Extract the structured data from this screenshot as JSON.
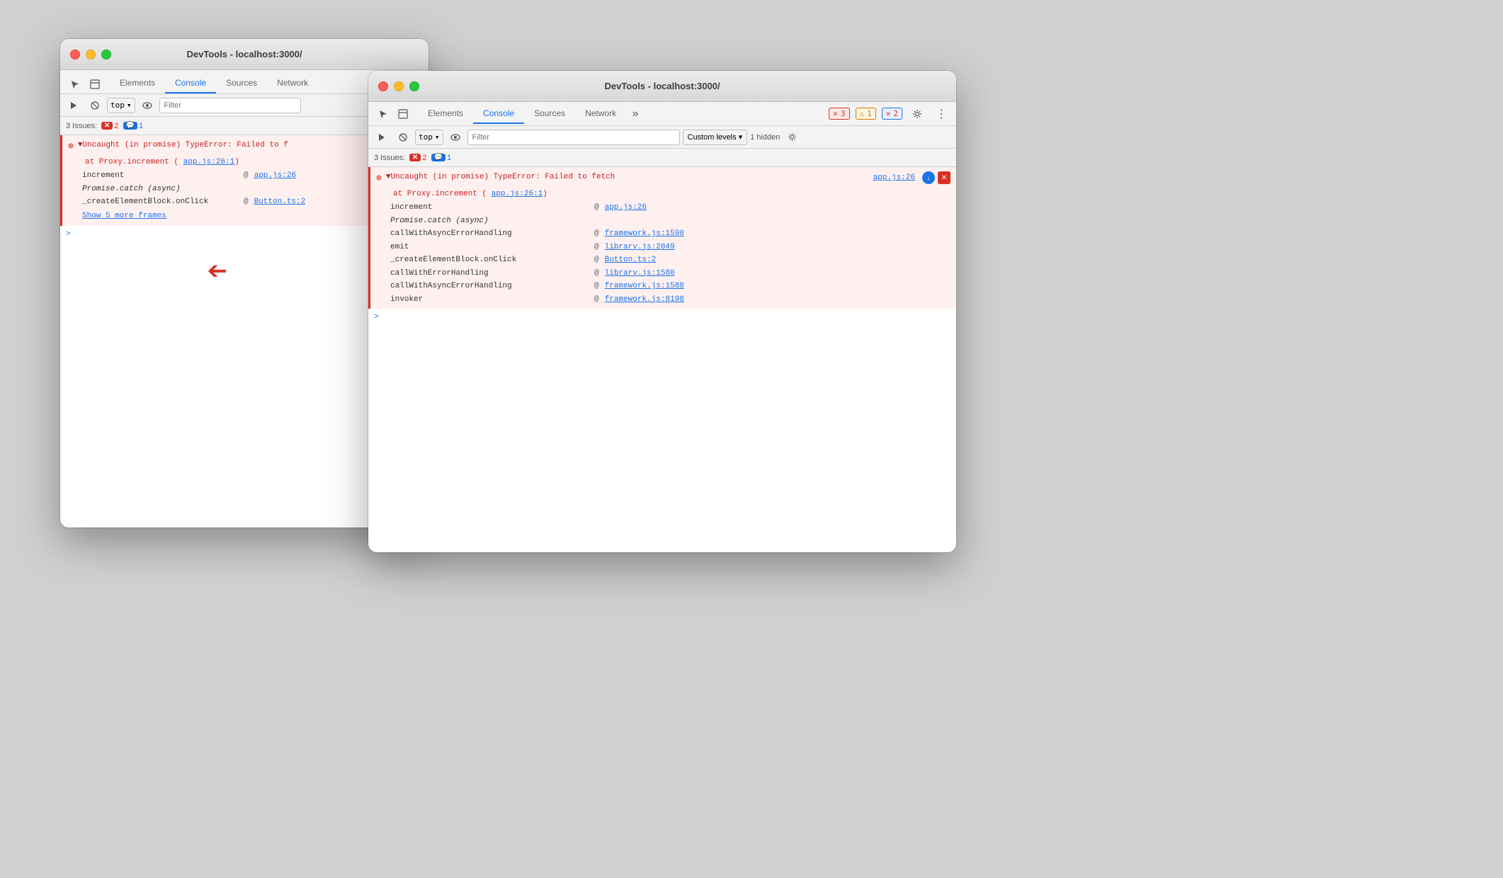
{
  "window1": {
    "title": "DevTools - localhost:3000/",
    "tabs": [
      "Elements",
      "Console",
      "Sources",
      "Network"
    ],
    "active_tab": "Console",
    "filter_placeholder": "Filter",
    "top_label": "top",
    "issues_label": "3 Issues:",
    "issues_error_count": "2",
    "issues_info_count": "1",
    "error_main": "▼Uncaught (in promise) TypeError: Failed to f",
    "error_at": "at Proxy.increment (",
    "error_link": "app.js:26:1",
    "stack": [
      {
        "fn": "increment",
        "at": "@",
        "link": "app.js:26"
      },
      {
        "fn": "Promise.catch (async)",
        "at": "",
        "link": ""
      },
      {
        "fn": "_createElementBlock.onClick",
        "at": "@",
        "link": "Button.ts:2"
      }
    ],
    "show_frames": "Show 5 more frames",
    "cursor": ">"
  },
  "window2": {
    "title": "DevTools - localhost:3000/",
    "tabs": [
      "Elements",
      "Console",
      "Sources",
      "Network"
    ],
    "active_tab": "Console",
    "filter_placeholder": "Filter",
    "top_label": "top",
    "custom_levels": "Custom levels",
    "hidden_count": "1 hidden",
    "issues_label": "3 Issues:",
    "issues_error_count": "2",
    "issues_info_count": "1",
    "header_badges": {
      "error_count": "3",
      "warning_count": "1",
      "info_count": "2"
    },
    "error_main": "▼Uncaught (in promise) TypeError: Failed to fetch",
    "error_at": "at Proxy.increment (",
    "error_link_main": "app.js:26",
    "error_link_at": "app.js:26:1",
    "error_file_link": "app.js:26",
    "stack": [
      {
        "fn": "increment",
        "at": "@",
        "link": "app.js:26"
      },
      {
        "fn": "Promise.catch (async)",
        "at": "",
        "link": ""
      },
      {
        "fn": "callWithAsyncErrorHandling",
        "at": "@",
        "link": "framework.js:1590"
      },
      {
        "fn": "emit",
        "at": "@",
        "link": "library.js:2049"
      },
      {
        "fn": "_createElementBlock.onClick",
        "at": "@",
        "link": "Button.ts:2"
      },
      {
        "fn": "callWithErrorHandling",
        "at": "@",
        "link": "library.js:1580"
      },
      {
        "fn": "callWithAsyncErrorHandling",
        "at": "@",
        "link": "framework.js:1588"
      },
      {
        "fn": "invoker",
        "at": "@",
        "link": "framework.js:8198"
      }
    ],
    "cursor": ">"
  },
  "arrow": {
    "symbol": "➔"
  }
}
